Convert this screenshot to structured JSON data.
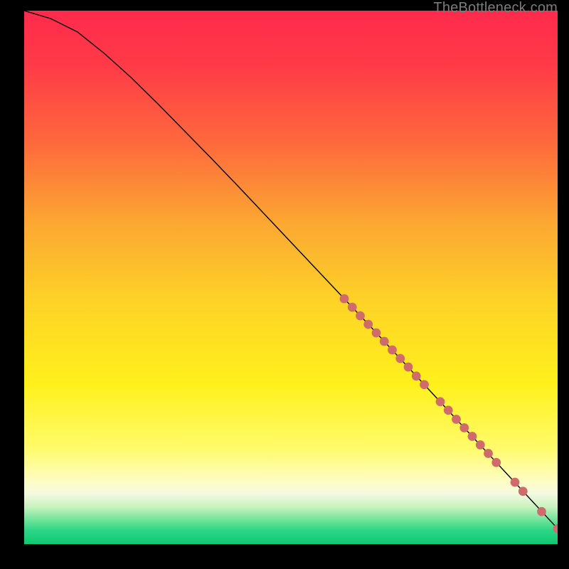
{
  "watermark": "TheBottleneck.com",
  "colors": {
    "bg": "#000000",
    "watermark": "#7c7c7c",
    "curve": "#000000",
    "dots": "#cf6b6b",
    "gradient_stops": [
      {
        "offset": 0.0,
        "color": "#ff2a4d"
      },
      {
        "offset": 0.1,
        "color": "#ff3a47"
      },
      {
        "offset": 0.25,
        "color": "#fd6a3c"
      },
      {
        "offset": 0.4,
        "color": "#fca832"
      },
      {
        "offset": 0.55,
        "color": "#fdd426"
      },
      {
        "offset": 0.7,
        "color": "#fff01c"
      },
      {
        "offset": 0.82,
        "color": "#fffb6a"
      },
      {
        "offset": 0.885,
        "color": "#fdfcc7"
      },
      {
        "offset": 0.905,
        "color": "#f4fae1"
      },
      {
        "offset": 0.93,
        "color": "#c8f3bf"
      },
      {
        "offset": 0.955,
        "color": "#6fe39a"
      },
      {
        "offset": 0.975,
        "color": "#2bd585"
      },
      {
        "offset": 1.0,
        "color": "#0dc971"
      }
    ]
  },
  "chart_data": {
    "type": "line",
    "title": "",
    "xlabel": "",
    "ylabel": "",
    "xlim": [
      0,
      100
    ],
    "ylim": [
      0,
      100
    ],
    "curve": [
      {
        "x": 0,
        "y": 100
      },
      {
        "x": 5,
        "y": 98.5
      },
      {
        "x": 10,
        "y": 96.0
      },
      {
        "x": 15,
        "y": 92.0
      },
      {
        "x": 20,
        "y": 87.5
      },
      {
        "x": 25,
        "y": 82.6
      },
      {
        "x": 30,
        "y": 77.5
      },
      {
        "x": 35,
        "y": 72.4
      },
      {
        "x": 40,
        "y": 67.2
      },
      {
        "x": 45,
        "y": 61.9
      },
      {
        "x": 50,
        "y": 56.6
      },
      {
        "x": 55,
        "y": 51.3
      },
      {
        "x": 60,
        "y": 46.0
      },
      {
        "x": 65,
        "y": 40.7
      },
      {
        "x": 70,
        "y": 35.3
      },
      {
        "x": 75,
        "y": 29.9
      },
      {
        "x": 80,
        "y": 24.5
      },
      {
        "x": 85,
        "y": 19.1
      },
      {
        "x": 90,
        "y": 13.7
      },
      {
        "x": 95,
        "y": 8.3
      },
      {
        "x": 100,
        "y": 2.9
      }
    ],
    "highlight_points": [
      {
        "x": 60.0,
        "y": 46.0
      },
      {
        "x": 61.5,
        "y": 44.4
      },
      {
        "x": 63.0,
        "y": 42.8
      },
      {
        "x": 64.5,
        "y": 41.2
      },
      {
        "x": 66.0,
        "y": 39.6
      },
      {
        "x": 67.5,
        "y": 38.0
      },
      {
        "x": 69.0,
        "y": 36.4
      },
      {
        "x": 70.5,
        "y": 34.8
      },
      {
        "x": 72.0,
        "y": 33.2
      },
      {
        "x": 73.5,
        "y": 31.5
      },
      {
        "x": 75.0,
        "y": 29.9
      },
      {
        "x": 78.0,
        "y": 26.7
      },
      {
        "x": 79.5,
        "y": 25.1
      },
      {
        "x": 81.0,
        "y": 23.4
      },
      {
        "x": 82.5,
        "y": 21.8
      },
      {
        "x": 84.0,
        "y": 20.2
      },
      {
        "x": 85.5,
        "y": 18.6
      },
      {
        "x": 87.0,
        "y": 17.0
      },
      {
        "x": 88.5,
        "y": 15.3
      },
      {
        "x": 92.0,
        "y": 11.6
      },
      {
        "x": 93.5,
        "y": 9.9
      },
      {
        "x": 97.0,
        "y": 6.1
      },
      {
        "x": 100.0,
        "y": 2.9
      }
    ]
  }
}
